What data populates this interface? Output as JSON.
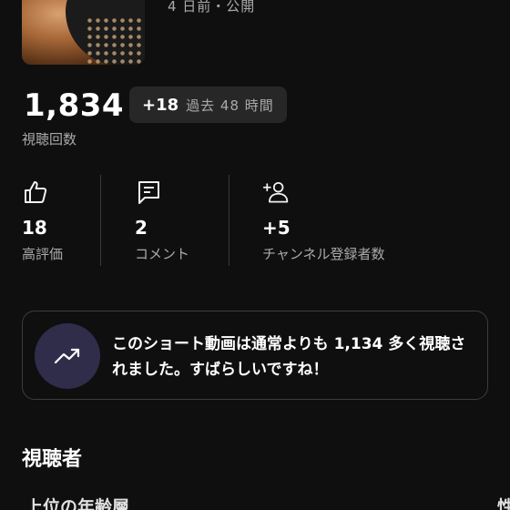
{
  "video": {
    "meta": "4 日前・公開"
  },
  "views": {
    "count": "1,834",
    "delta": "+18",
    "period": "過去 48 時間",
    "label": "視聴回数"
  },
  "stats": [
    {
      "icon": "thumbs-up-icon",
      "value": "18",
      "label": "高評価"
    },
    {
      "icon": "comment-icon",
      "value": "2",
      "label": "コメント"
    },
    {
      "icon": "add-subscriber-icon",
      "value": "+5",
      "label": "チャンネル登録者数"
    }
  ],
  "insight": {
    "icon": "trending-up-icon",
    "text": "このショート動画は通常よりも 1,134 多く視聴されました。すばらしいですね！",
    "accent_color": "#2f2d4a"
  },
  "audience": {
    "title": "視聴者",
    "subtitle": "上位の年齢層",
    "edge_text": "性"
  },
  "colors": {
    "background": "#0f0f0f",
    "chip": "#272727",
    "secondary_text": "#aaaaaa"
  }
}
